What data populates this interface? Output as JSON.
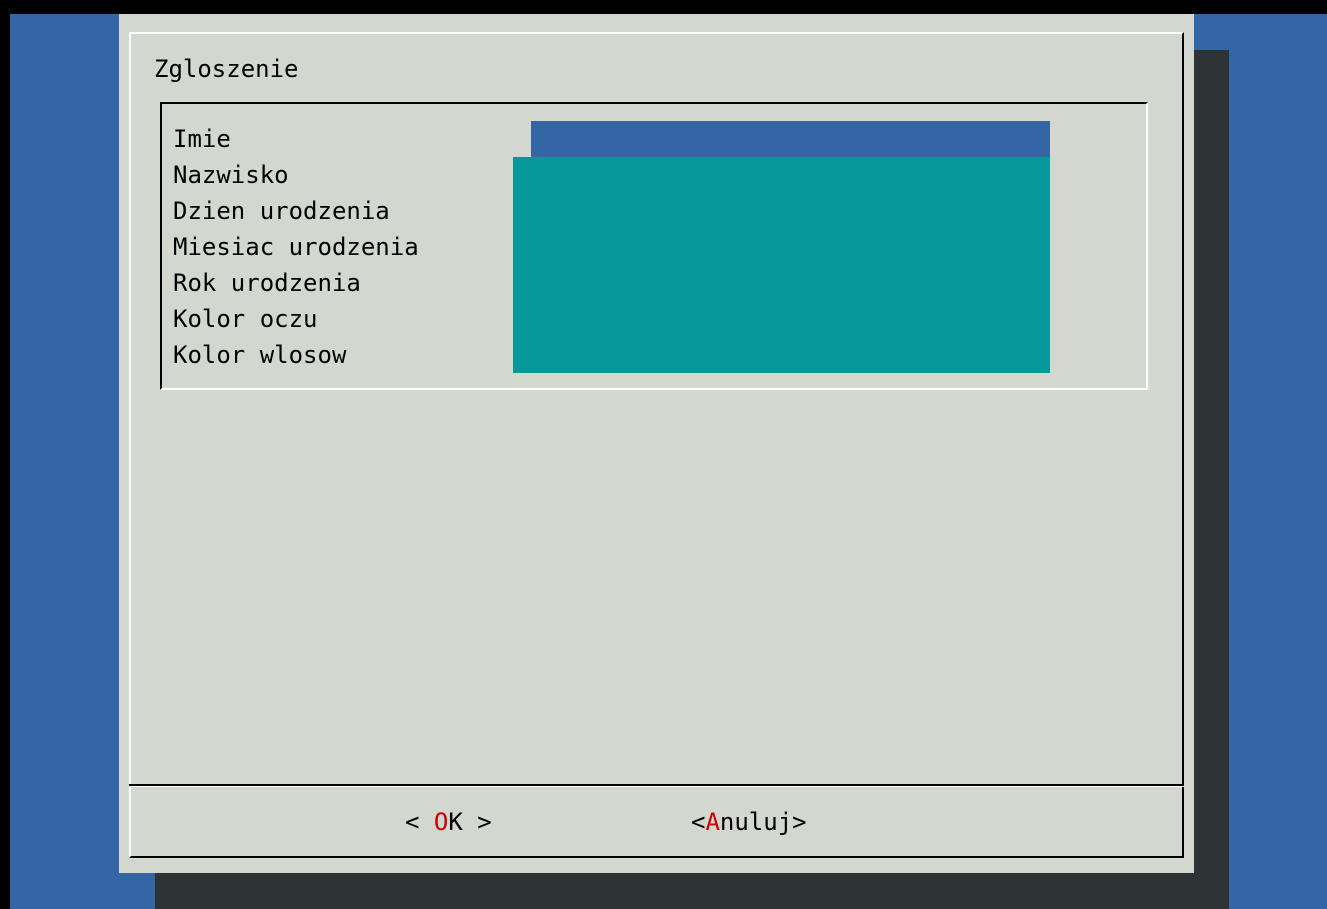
{
  "dialog": {
    "title": "Zgloszenie"
  },
  "form": {
    "fields": [
      {
        "label": "Imie",
        "value": "",
        "active": true
      },
      {
        "label": "Nazwisko",
        "value": "",
        "active": false
      },
      {
        "label": "Dzien urodzenia",
        "value": "",
        "active": false
      },
      {
        "label": "Miesiac urodzenia",
        "value": "",
        "active": false
      },
      {
        "label": "Rok urodzenia",
        "value": "",
        "active": false
      },
      {
        "label": "Kolor oczu",
        "value": "",
        "active": false
      },
      {
        "label": "Kolor wlosow",
        "value": "",
        "active": false
      }
    ]
  },
  "buttons": {
    "ok": {
      "left": "< ",
      "hot": "O",
      "rest": "K",
      "right": " >"
    },
    "cancel": {
      "left": "<",
      "hot": "A",
      "rest": "nuluj",
      "right": ">"
    }
  },
  "colors": {
    "desktop": "#3465a4",
    "dialog_bg": "#d3d7cf",
    "shadow": "#2e3436",
    "active_field": "#3465a4",
    "inactive_field": "#06989a",
    "hotkey": "#cc0000"
  }
}
